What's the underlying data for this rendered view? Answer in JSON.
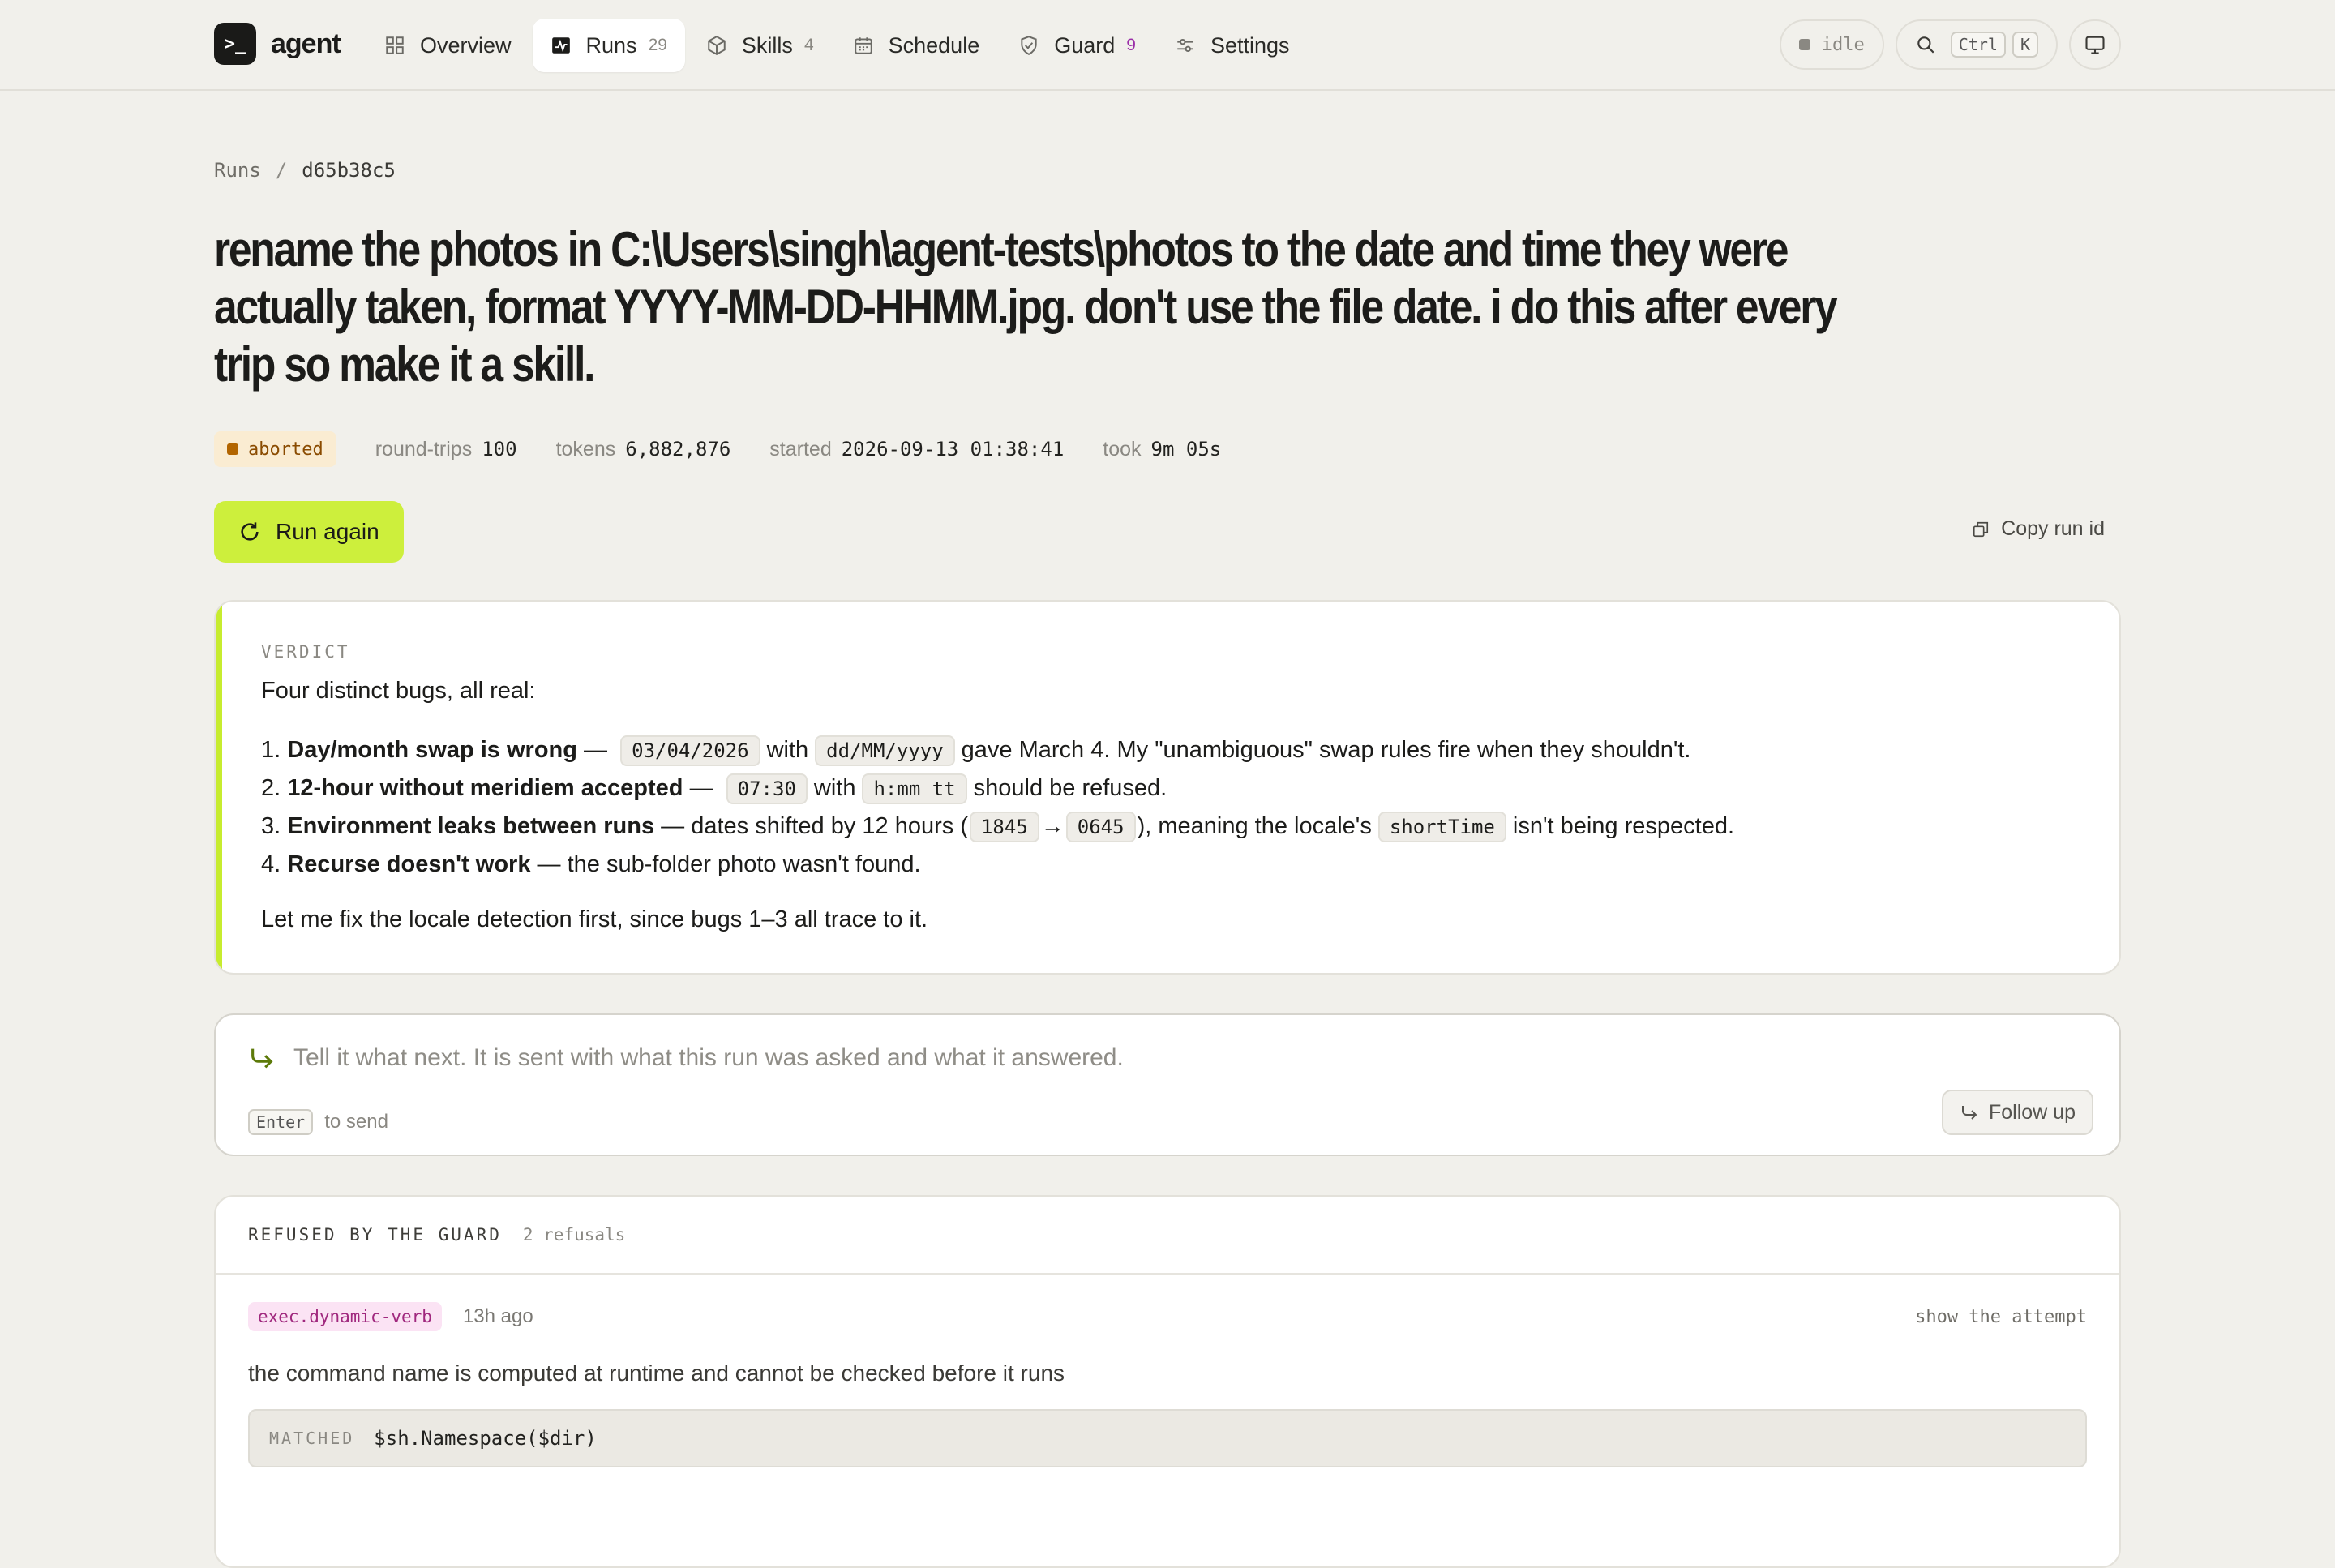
{
  "brand": {
    "logo": ">_",
    "name": "agent"
  },
  "nav": [
    {
      "label": "Overview",
      "icon": "grid-icon",
      "count": ""
    },
    {
      "label": "Runs",
      "icon": "activity-icon",
      "count": "29",
      "active": true
    },
    {
      "label": "Skills",
      "icon": "box-icon",
      "count": "4"
    },
    {
      "label": "Schedule",
      "icon": "calendar-icon",
      "count": ""
    },
    {
      "label": "Guard",
      "icon": "shield-icon",
      "count": "9"
    },
    {
      "label": "Settings",
      "icon": "sliders-icon",
      "count": ""
    }
  ],
  "topright": {
    "status": "idle",
    "search_kbd1": "Ctrl",
    "search_kbd2": "K"
  },
  "breadcrumb": {
    "root": "Runs",
    "sep": "/",
    "current": "d65b38c5"
  },
  "run": {
    "title": "rename the photos in C:\\Users\\singh\\agent-tests\\photos to the date and time they were actually taken, format YYYY-MM-DD-HHMM.jpg. don't use the file date. i do this after every trip so make it a skill.",
    "status": "aborted",
    "roundtrips_label": "round-trips",
    "roundtrips": "100",
    "tokens_label": "tokens",
    "tokens": "6,882,876",
    "started_label": "started",
    "started": "2026-09-13 01:38:41",
    "took_label": "took",
    "took": "9m 05s"
  },
  "actions": {
    "run_again": "Run again",
    "copy_run_id": "Copy run id"
  },
  "verdict": {
    "label": "VERDICT",
    "intro": "Four distinct bugs, all real:",
    "items": [
      {
        "n": "1.",
        "bold": "Day/month swap is wrong",
        "t1": " — ",
        "c1": "03/04/2026",
        "t2": "with",
        "c2": "dd/MM/yyyy",
        "t3": "gave March 4. My \"unambiguous\" swap rules fire when they shouldn't."
      },
      {
        "n": "2.",
        "bold": "12-hour without meridiem accepted",
        "t1": " — ",
        "c1": "07:30",
        "t2": "with",
        "c2": "h:mm tt",
        "t3": "should be refused."
      },
      {
        "n": "3.",
        "bold": "Environment leaks between runs",
        "t1": " — dates shifted by 12 hours (",
        "c1": "1845",
        "t2": "→",
        "c2": "0645",
        "t3": "), meaning the locale's",
        "c3": "shortTime",
        "t4": "isn't being respected."
      },
      {
        "n": "4.",
        "bold": "Recurse doesn't work",
        "t1": " — the sub-folder photo wasn't found."
      }
    ],
    "outro": "Let me fix the locale detection first, since bugs 1–3 all trace to it."
  },
  "followup": {
    "placeholder": "Tell it what next. It is sent with what this run was asked and what it answered.",
    "enter_kbd": "Enter",
    "enter_hint": "to send",
    "button": "Follow up"
  },
  "guard": {
    "title": "REFUSED BY THE GUARD",
    "count": "2 refusals",
    "refusal": {
      "rule": "exec.dynamic-verb",
      "time": "13h ago",
      "show": "show the attempt",
      "desc": "the command name is computed at runtime and cannot be checked before it runs",
      "matched_label": "MATCHED",
      "matched_code": "$sh.Namespace($dir)"
    }
  },
  "colors": {
    "accent": "#cdef3c",
    "aborted_bg": "#faecd2",
    "aborted_fg": "#8a4b00",
    "rule_bg": "#fbe3f4",
    "rule_fg": "#a0287e"
  }
}
